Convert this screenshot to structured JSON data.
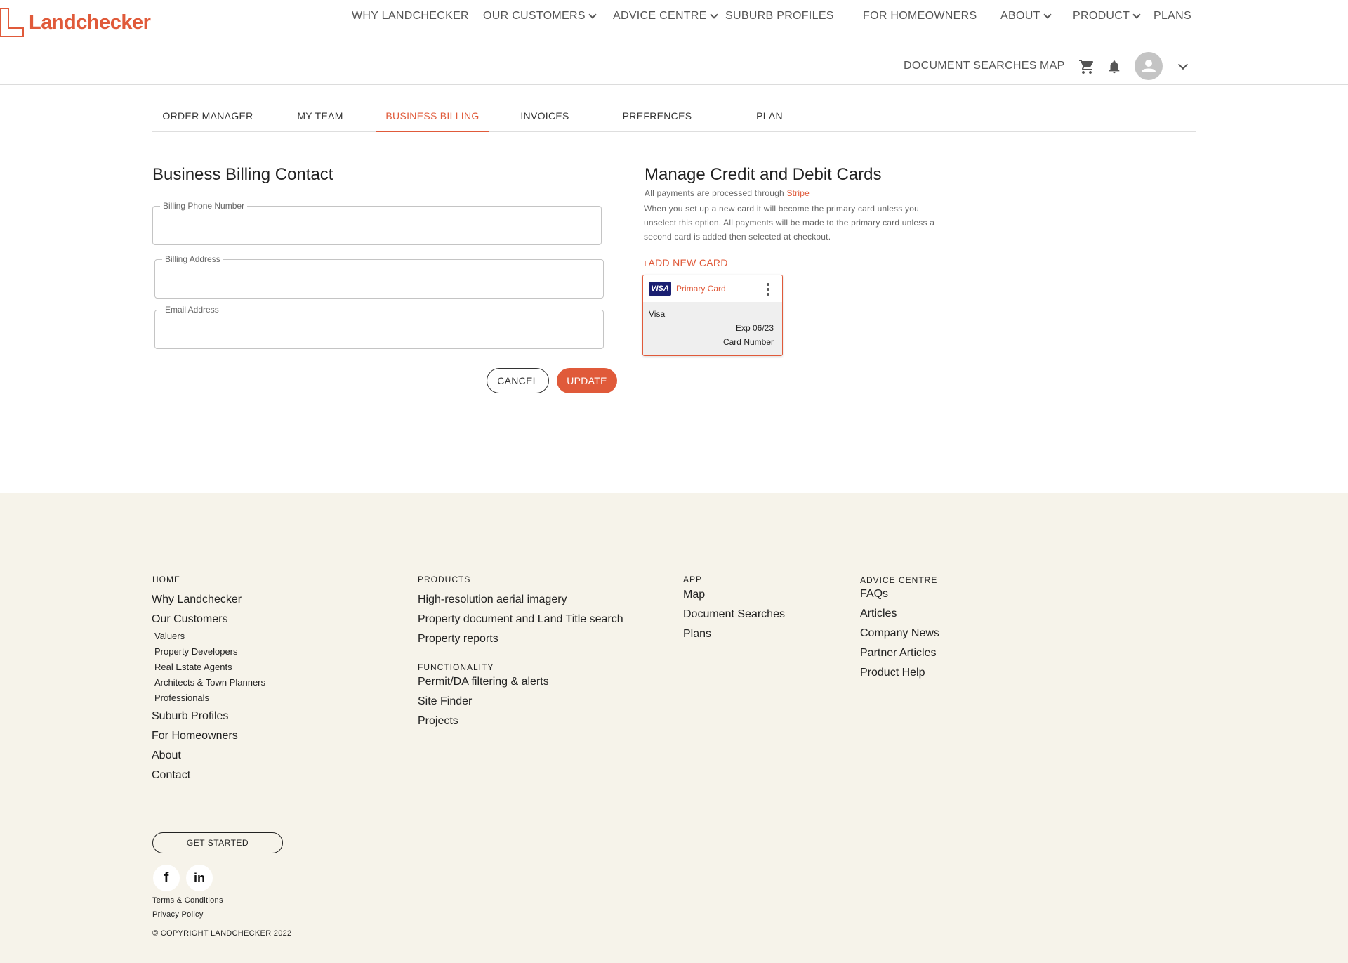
{
  "brand": {
    "name": "Landchecker",
    "accent_color": "#e05a3a"
  },
  "topnav": {
    "items": [
      {
        "label": "WHY LANDCHECKER"
      },
      {
        "label": "OUR CUSTOMERS"
      },
      {
        "label": "ADVICE CENTRE"
      },
      {
        "label": "SUBURB PROFILES"
      },
      {
        "label": "FOR HOMEOWNERS"
      },
      {
        "label": "ABOUT"
      },
      {
        "label": "PRODUCT"
      },
      {
        "label": "PLANS"
      }
    ]
  },
  "subnav": {
    "document_searches": "DOCUMENT SEARCHES",
    "map": "MAP",
    "icons": [
      "cart-icon",
      "bell-icon",
      "avatar",
      "chevron-down-icon"
    ]
  },
  "tabs": [
    {
      "label": "ORDER MANAGER"
    },
    {
      "label": "MY TEAM"
    },
    {
      "label": "BUSINESS BILLING",
      "active": true
    },
    {
      "label": "INVOICES"
    },
    {
      "label": "PREFRENCES"
    },
    {
      "label": "PLAN"
    }
  ],
  "billing": {
    "title": "Business Billing Contact",
    "phone_label": "Billing Phone  Number",
    "phone_value": "",
    "address_label": "Billing Address",
    "address_value": "",
    "email_label": "Email Address",
    "email_value": "",
    "cancel_label": "CANCEL",
    "update_label": "UPDATE"
  },
  "cards": {
    "title": "Manage Credit and Debit Cards",
    "stripe_note": "All payments are processed through",
    "stripe_link": "Stripe",
    "desc_line1": "When you set up a new card it will become the primary card unless you",
    "desc_line2": "unselect this option. All payments will be made to the primary card unless a",
    "desc_line3": "second card is added then selected at checkout.",
    "add_label": "+ADD NEW CARD",
    "card": {
      "badge": "VISA",
      "status": "Primary Card",
      "brand": "Visa",
      "expiry": "Exp 06/23",
      "number_label": "Card Number"
    }
  },
  "footer": {
    "home": {
      "heading": "HOME",
      "links": [
        "Why Landchecker",
        "Our Customers"
      ],
      "sublinks": [
        "Valuers",
        "Property Developers",
        "Real Estate Agents",
        "Architects & Town Planners",
        "Professionals"
      ],
      "more_links": [
        "Suburb Profiles",
        "For Homeowners",
        "About",
        "Contact"
      ]
    },
    "products": {
      "heading": "PRODUCTS",
      "links": [
        "High-resolution aerial imagery",
        "Property document and Land Title search",
        "Property reports"
      ]
    },
    "functionality": {
      "heading": "FUNCTIONALITY",
      "links": [
        "Permit/DA filtering & alerts",
        "Site Finder",
        "Projects"
      ]
    },
    "app": {
      "heading": "APP",
      "links": [
        "Map",
        "Document Searches",
        "Plans"
      ]
    },
    "advice": {
      "heading": "ADVICE CENTRE",
      "links": [
        "FAQs",
        "Articles",
        "Company News",
        "Partner Articles",
        "Product Help"
      ]
    },
    "get_started": "GET STARTED",
    "social": [
      "f",
      "in"
    ],
    "terms": "Terms & Conditions",
    "privacy": "Privacy Policy",
    "copyright": "© COPYRIGHT LANDCHECKER 2022"
  }
}
